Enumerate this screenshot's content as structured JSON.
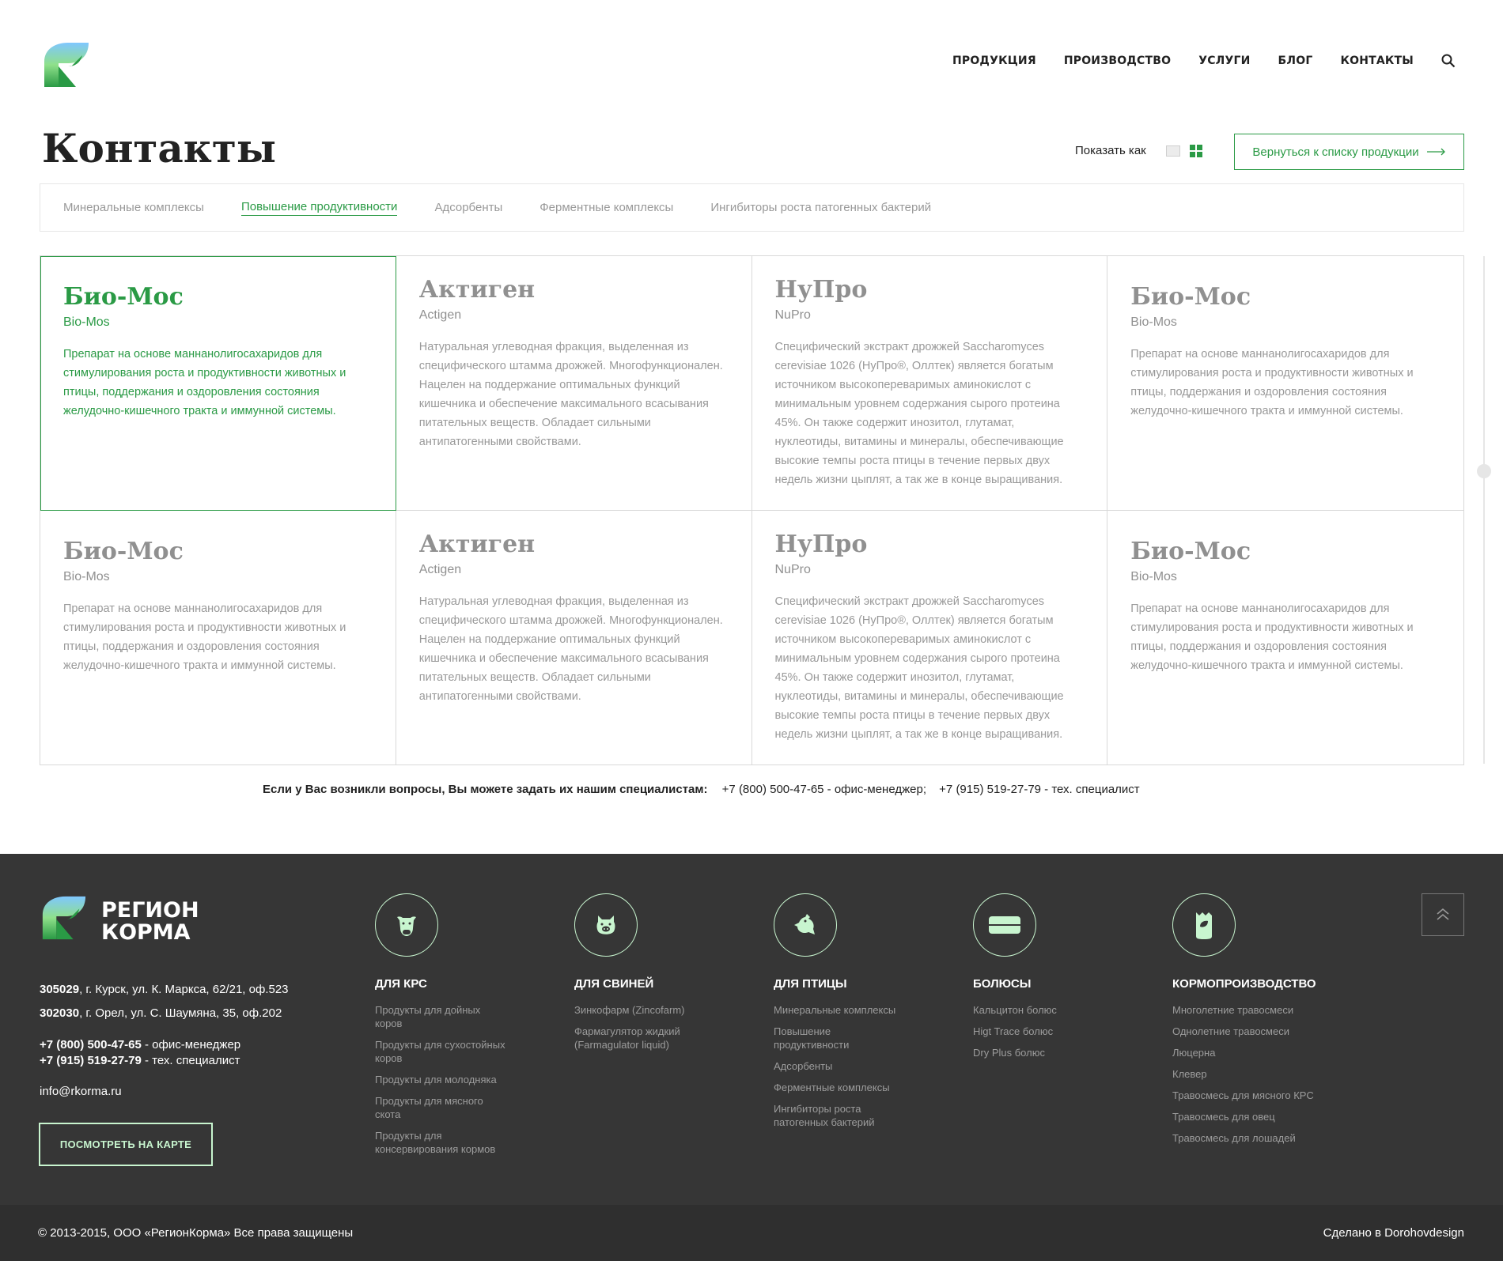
{
  "nav": {
    "items": [
      "ПРОДУКЦИЯ",
      "ПРОИЗВОДСТВО",
      "УСЛУГИ",
      "БЛОГ",
      "КОНТАКТЫ"
    ]
  },
  "page": {
    "title": "Контакты",
    "show_as_label": "Показать как",
    "back_button_label": "Вернуться к списку продукции"
  },
  "tabs": [
    {
      "label": "Минеральные комплексы",
      "active": false
    },
    {
      "label": "Повышение продуктивности",
      "active": true
    },
    {
      "label": "Адсорбенты",
      "active": false
    },
    {
      "label": "Ферментные комплексы",
      "active": false
    },
    {
      "label": "Ингибиторы роста патогенных бактерий",
      "active": false
    }
  ],
  "products": [
    {
      "title": "Био-Мос",
      "sub": "Bio-Mos",
      "desc": "Препарат на основе маннанолигосахаридов для стимулирования роста и продуктивности животных и птицы, поддержания и оздоровления состояния желудочно-кишечного тракта и иммунной системы."
    },
    {
      "title": "Актиген",
      "sub": "Actigen",
      "desc": "Натуральная углеводная фракция, выделенная из специфического штамма дрожжей. Многофункционален. Нацелен на поддержание оптимальных функций кишечника и обеспечение максимального всасывания питательных веществ. Обладает сильными антипатогенными свойствами."
    },
    {
      "title": "НуПро",
      "sub": "NuPro",
      "desc": "Специфический экстракт дрожжей Saccharomyces cerevisiae 1026 (НуПро®, Оллтек) является богатым источником высокопереваримых аминокислот с минимальным уровнем содержания сырого протеина 45%. Он также содержит инозитол, глутамат, нуклеотиды, витамины и минералы, обеспечивающие высокие темпы роста птицы в течение первых двух недель жизни цыплят, а так же в конце выращивания."
    },
    {
      "title": "Био-Мос",
      "sub": "Bio-Mos",
      "desc": "Препарат на основе маннанолигосахаридов для стимулирования роста и продуктивности животных и птицы, поддержания и оздоровления состояния желудочно-кишечного тракта и иммунной системы."
    },
    {
      "title": "Био-Мос",
      "sub": "Bio-Mos",
      "desc": "Препарат на основе маннанолигосахаридов для стимулирования роста и продуктивности животных и птицы, поддержания и оздоровления состояния желудочно-кишечного тракта и иммунной системы."
    },
    {
      "title": "Актиген",
      "sub": "Actigen",
      "desc": "Натуральная углеводная фракция, выделенная из специфического штамма дрожжей. Многофункционален. Нацелен на поддержание оптимальных функций кишечника и обеспечение максимального всасывания питательных веществ. Обладает сильными антипатогенными свойствами."
    },
    {
      "title": "НуПро",
      "sub": "NuPro",
      "desc": "Специфический экстракт дрожжей Saccharomyces cerevisiae 1026 (НуПро®, Оллтек) является богатым источником высокопереваримых аминокислот с минимальным уровнем содержания сырого протеина 45%. Он также содержит инозитол, глутамат, нуклеотиды, витамины и минералы, обеспечивающие высокие темпы роста птицы в течение первых двух недель жизни цыплят, а так же в конце выращивания."
    },
    {
      "title": "Био-Мос",
      "sub": "Bio-Mos",
      "desc": "Препарат на основе маннанолигосахаридов для стимулирования роста и продуктивности животных и птицы, поддержания и оздоровления состояния желудочно-кишечного тракта и иммунной системы."
    }
  ],
  "contact": {
    "question": "Если у Вас возникли вопросы, Вы можете задать их нашим специалистам:",
    "phone1": "+7 (800) 500-47-65 - офис-менеджер;",
    "phone2": "+7 (915) 519-27-79 - тех. специалист"
  },
  "footer": {
    "brand_line1": "РЕГИОН",
    "brand_line2": "КОРМА",
    "addr1_code": "305029",
    "addr1_rest": ", г. Курск, ул. К. Маркса, 62/21, оф.523",
    "addr2_code": "302030",
    "addr2_rest": ", г. Орел, ул. С. Шаумяна, 35, оф.202",
    "phone1_num": "+7 (800) 500-47-65",
    "phone1_rest": " - офис-менеджер",
    "phone2_num": "+7 (915) 519-27-79",
    "phone2_rest": " - тех. специалист",
    "email": "info@rkorma.ru",
    "map_button": "ПОСМОТРЕТЬ НА КАРТЕ",
    "columns": [
      {
        "icon": "cow-icon",
        "title": "ДЛЯ КРС",
        "items": [
          "Продукты для дойных коров",
          "Продукты для сухостойных коров",
          "Продукты для молодняка",
          "Продукты для мясного скота",
          "Продукты для консервирования кормов"
        ]
      },
      {
        "icon": "pig-icon",
        "title": "ДЛЯ СВИНЕЙ",
        "items": [
          "Зинкофарм (Zincofarm)",
          "Фармагулятор жидкий (Farmagulator liquid)"
        ]
      },
      {
        "icon": "bird-icon",
        "title": "ДЛЯ ПТИЦЫ",
        "items": [
          "Минеральные комплексы",
          "Повышение продуктивности",
          "Адсорбенты",
          "Ферментные комплексы",
          "Ингибиторы роста патогенных бактерий"
        ]
      },
      {
        "icon": "bolus-icon",
        "title": "БОЛЮСЫ",
        "items": [
          "Кальцитон болюс",
          "Higt Trace болюс",
          "Dry Plus болюс"
        ]
      },
      {
        "icon": "seed-bag-icon",
        "title": "КОРМОПРОИЗВОДСТВО",
        "items": [
          "Многолетние травосмеси",
          "Однолетние травосмеси",
          "Люцерна",
          "Клевер",
          "Травосмесь для мясного КРС",
          "Травосмесь для овец",
          "Травосмесь для лошадей"
        ]
      }
    ],
    "copyright": "© 2013-2015, ООО «РегионКорма»  Все права защищены",
    "credit": "Сделано в Dorohovdesign"
  },
  "colors": {
    "accent": "#2a9a45",
    "footer_bg": "#363636",
    "footer_accent": "#c8f5cf"
  }
}
